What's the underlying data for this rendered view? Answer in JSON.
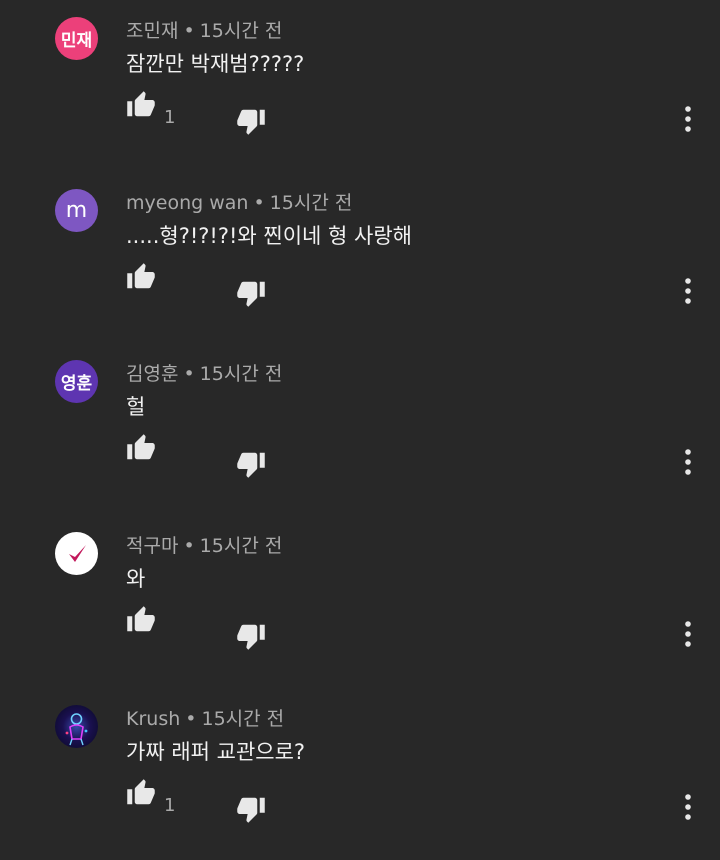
{
  "comments": [
    {
      "avatar": {
        "label": "민재",
        "color": "#ec407a"
      },
      "author": "조민재",
      "time": "15시간 전",
      "text": "잠깐만 박재범?????",
      "likes": "1"
    },
    {
      "avatar": {
        "label": "m",
        "color": "#7e57c2"
      },
      "author": "myeong wan",
      "time": "15시간 전",
      "text": ".....형?!?!?!와 찐이네 형 사랑해",
      "likes": ""
    },
    {
      "avatar": {
        "label": "영훈",
        "color": "#5e35b1"
      },
      "author": "김영훈",
      "time": "15시간 전",
      "text": "헐",
      "likes": ""
    },
    {
      "avatar": {
        "label": "",
        "color": "#ffffff",
        "icon": "check-mark-icon"
      },
      "author": "적구마",
      "time": "15시간 전",
      "text": "와",
      "likes": ""
    },
    {
      "avatar": {
        "label": "",
        "color": "#0b0b2e",
        "icon": "glowing-figure-image"
      },
      "author": "Krush",
      "time": "15시간 전",
      "text": "가짜 래퍼 교관으로?",
      "likes": "1"
    }
  ],
  "separator": "•",
  "colors": {
    "background": "#282828",
    "primary_text": "#f1f1f1",
    "secondary_text": "#aaaaaa",
    "icon": "#e8e8e8"
  }
}
